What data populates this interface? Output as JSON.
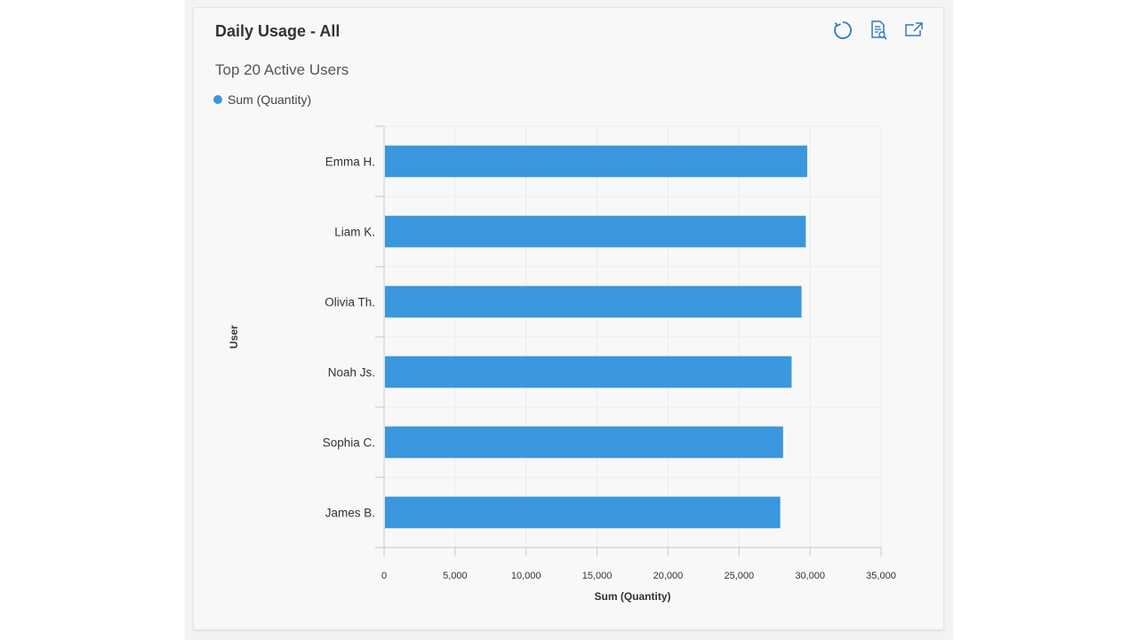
{
  "card": {
    "title": "Daily Usage - All",
    "toolbar": [
      {
        "icon": "refresh-icon"
      },
      {
        "icon": "view-report-icon"
      },
      {
        "icon": "expand-icon"
      }
    ]
  },
  "chart_data": {
    "type": "bar",
    "orientation": "horizontal",
    "title": "Top 20 Active Users",
    "xlabel": "Sum (Quantity)",
    "ylabel": "User",
    "legend": [
      "Sum (Quantity)"
    ],
    "legend_position": "top-left",
    "grid": true,
    "xlim": [
      0,
      35000
    ],
    "xticks": [
      0,
      5000,
      10000,
      15000,
      20000,
      25000,
      30000,
      35000
    ],
    "xtick_labels": [
      "0",
      "5,000",
      "10,000",
      "15,000",
      "20,000",
      "25,000",
      "30,000",
      "35,000"
    ],
    "categories": [
      "Emma H.",
      "Liam K.",
      "Olivia Th.",
      "Noah Js.",
      "Sophia C.",
      "James B."
    ],
    "series": [
      {
        "name": "Sum (Quantity)",
        "color": "#3b97dd",
        "values": [
          29800,
          29700,
          29400,
          28700,
          28100,
          27900
        ]
      }
    ]
  }
}
